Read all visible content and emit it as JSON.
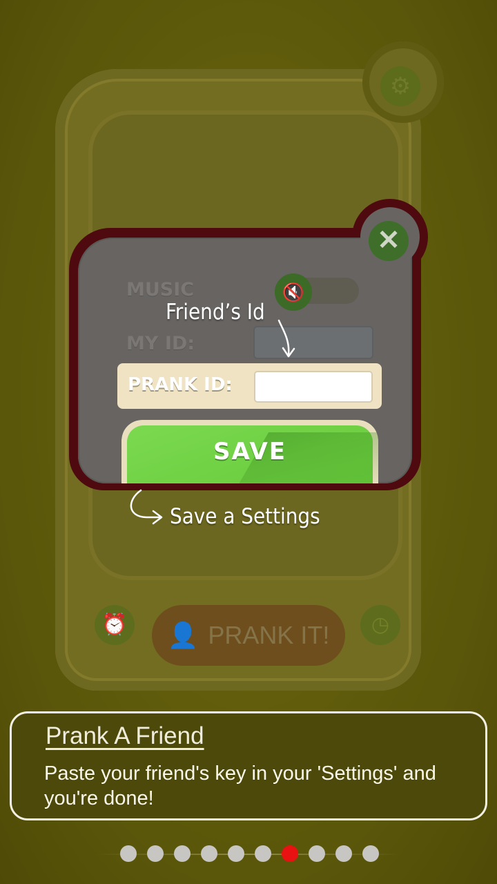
{
  "settings_dialog": {
    "music_label": "MUSIC",
    "my_id_label": "MY ID:",
    "prank_id_label": "PRANK ID:",
    "prank_id_value": "",
    "save_label": "SAVE"
  },
  "background_device": {
    "prank_button_label": "PRANK IT!"
  },
  "annotations": {
    "friend_id": "Friend’s Id",
    "save_settings": "Save a Settings"
  },
  "tutorial": {
    "title": "Prank A Friend",
    "body": "Paste your friend's key in your 'Settings' and you're done!"
  },
  "pager": {
    "total": 10,
    "current": 7
  },
  "colors": {
    "accent_green": "#6fd043",
    "dialog_border": "#4e0a0f",
    "pager_active": "#e81212"
  }
}
